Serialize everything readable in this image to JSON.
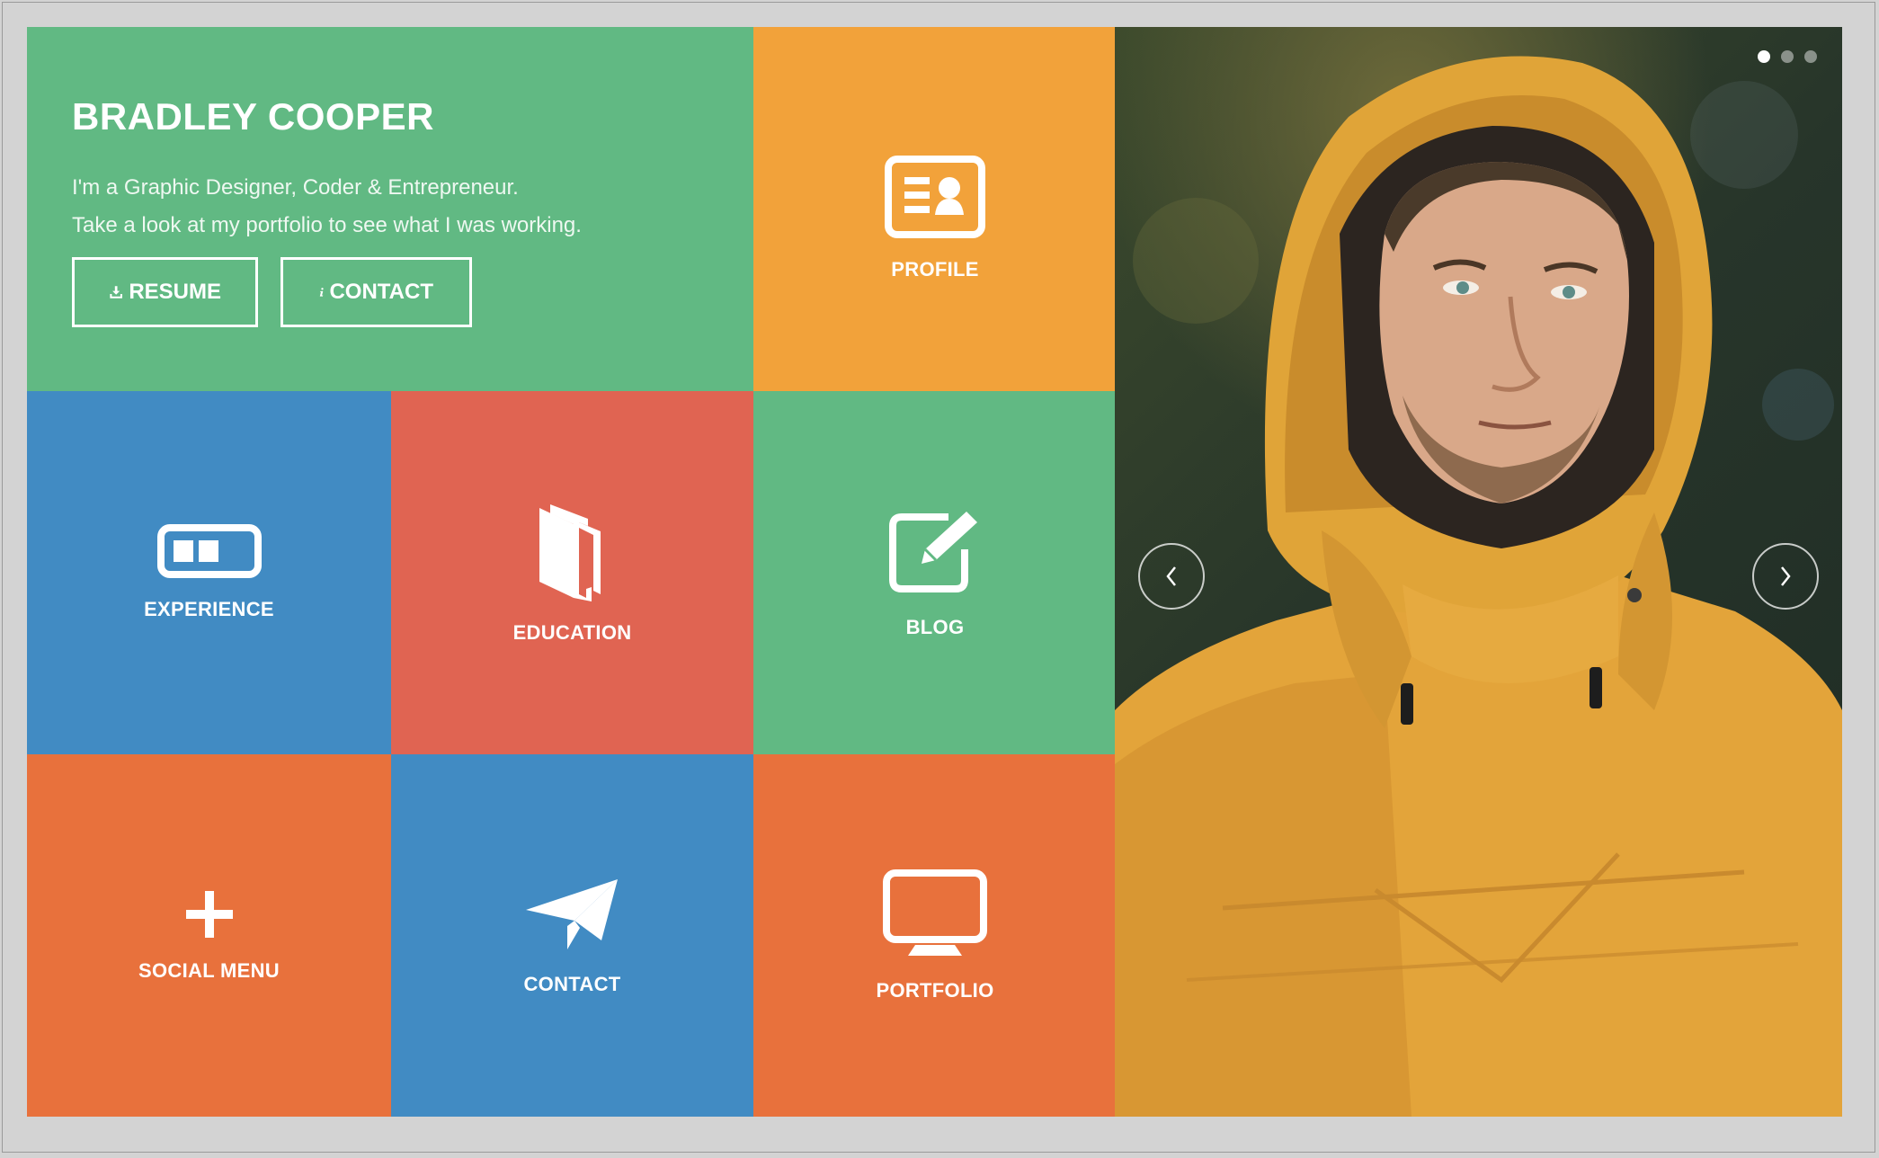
{
  "intro": {
    "name": "BRADLEY COOPER",
    "line1": "I'm a Graphic Designer, Coder & Entrepreneur.",
    "line2": "Take a look at my portfolio to see what I was working.",
    "resume_label": "RESUME",
    "contact_label": "CONTACT",
    "resume_icon": "download-icon",
    "contact_icon": "info-icon"
  },
  "tiles": {
    "profile": {
      "label": "PROFILE",
      "icon": "id-card-icon"
    },
    "experience": {
      "label": "EXPERIENCE",
      "icon": "progress-bar-icon"
    },
    "education": {
      "label": "EDUCATION",
      "icon": "book-icon"
    },
    "blog": {
      "label": "BLOG",
      "icon": "edit-icon"
    },
    "social": {
      "label": "SOCIAL MENU",
      "icon": "plus-icon"
    },
    "contact": {
      "label": "CONTACT",
      "icon": "paper-plane-icon"
    },
    "portfolio": {
      "label": "PORTFOLIO",
      "icon": "monitor-icon"
    }
  },
  "slider": {
    "image": "portrait-photo-man-in-yellow-hooded-jacket",
    "dots": 3,
    "active_dot": 1,
    "prev_icon": "chevron-left-icon",
    "next_icon": "chevron-right-icon"
  },
  "colors": {
    "green": "#61b983",
    "orange": "#f2a23a",
    "blue": "#418bc3",
    "red": "#e06452",
    "dark_orange": "#e8713c"
  }
}
